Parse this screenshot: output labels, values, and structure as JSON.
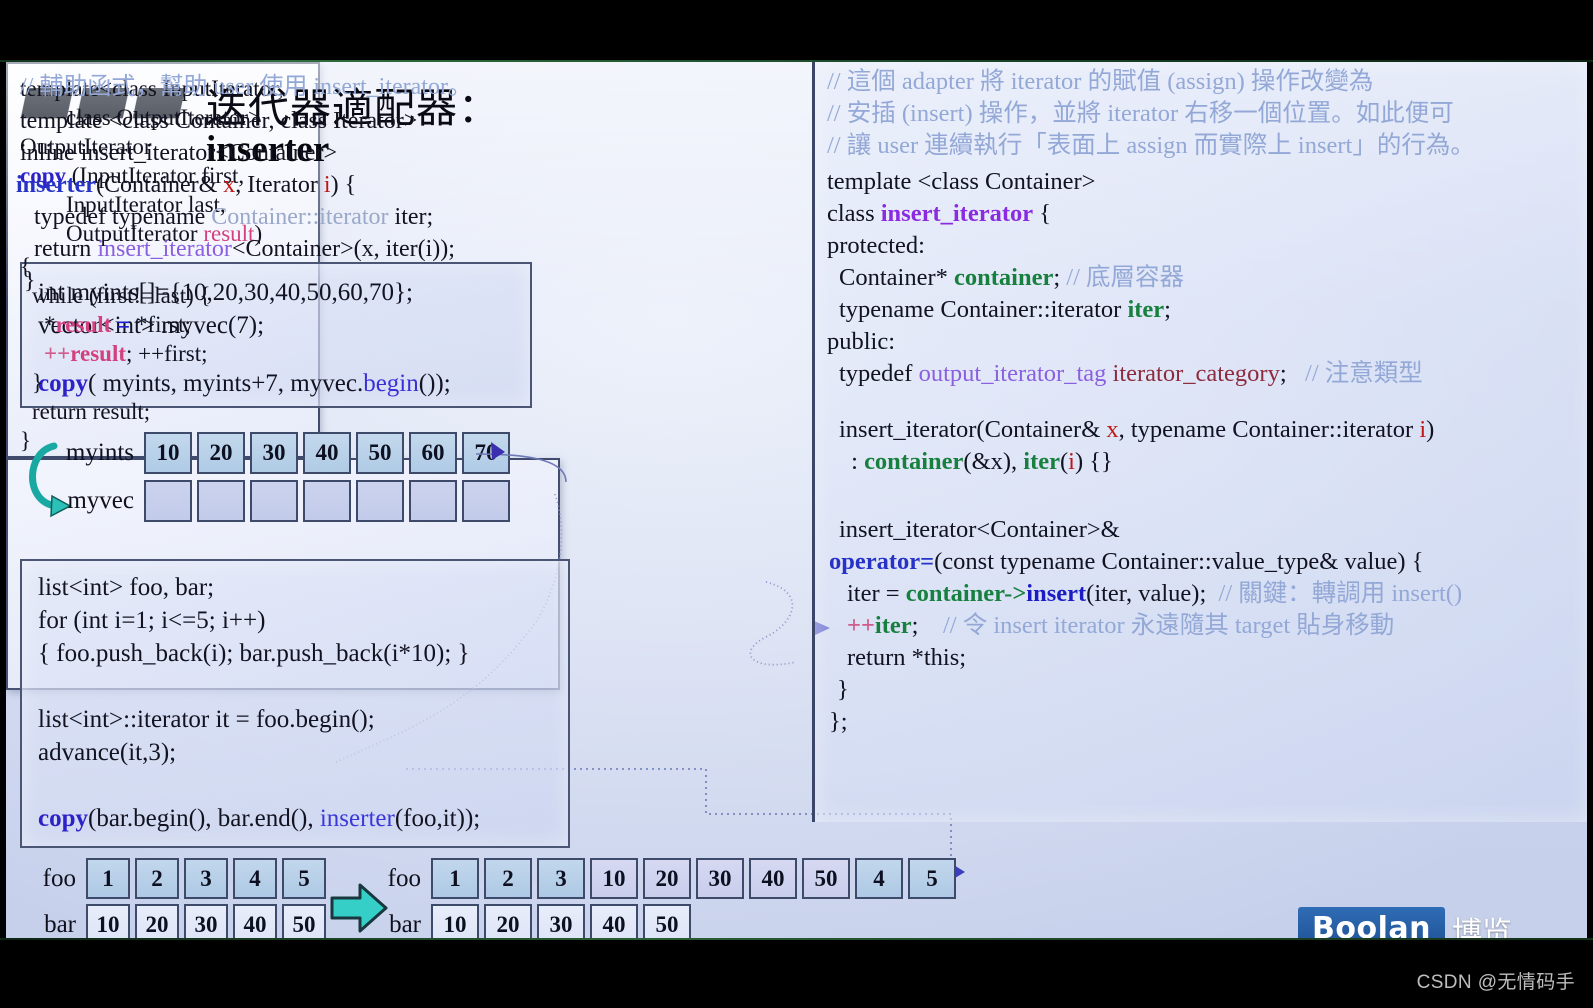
{
  "slide": {
    "title_zh": "迭代器適配器：",
    "title_en": "inserter",
    "tiles_count": 3
  },
  "code_vector_example": {
    "line1": "int myints[]={10,20,30,40,50,60,70};",
    "line2": "vector<int> myvec(7);",
    "line3_copy": "copy",
    "line3_mid": "( myints, myints+7, myvec.",
    "line3_begin": "begin",
    "line3_end": "());"
  },
  "vector_diagram": {
    "label_top": "myints",
    "label_bottom": "myvec",
    "values_top": [
      "10",
      "20",
      "30",
      "40",
      "50",
      "60",
      "70"
    ],
    "values_bottom": [
      "",
      "",
      "",
      "",
      "",
      "",
      ""
    ]
  },
  "code_list_example": {
    "line1": "list<int> foo, bar;",
    "line2": "for (int i=1; i<=5; i++)",
    "line3": "{ foo.push_back(i); bar.push_back(i*10); }",
    "line4": "list<int>::iterator it = foo.begin();",
    "line5": "advance(it,3);",
    "line6_copy": "copy",
    "line6_mid": "(bar.begin(), bar.end(), ",
    "line6_inserter": "inserter",
    "line6_end": "(foo,it));"
  },
  "copy_box": {
    "l1": "template<class InputIterator,",
    "l2": "class OutputIterator>",
    "l3": "OutputIterator",
    "l4_copy": "copy",
    "l4_rest": " (InputIterator first,",
    "l5": "InputIterator last,",
    "l6_pre": "OutputIterator ",
    "l6_result": "result",
    "l6_post": ")",
    "l7": "{",
    "l8": "while (first!=last) {",
    "l9_pre": "*",
    "l9_result": "result",
    "l9_eq": " = ",
    "l9_post": "*first;",
    "l10_pre": "++",
    "l10_result": "result",
    "l10_post": "; ++first;",
    "l11": "}",
    "l12": "return result;",
    "l13": "}"
  },
  "right_panel": {
    "comment1": "// 這個 adapter 將 iterator 的賦值 (assign) 操作改變為",
    "comment2": "// 安插 (insert) 操作，並將 iterator 右移一個位置。如此便可",
    "comment3": "// 讓 user 連續執行「表面上 assign 而實際上 insert」的行為。",
    "l4": "template <class Container>",
    "l5_pre": "class ",
    "l5_cls": "insert_iterator",
    "l5_post": " {",
    "l6": "protected:",
    "l7_pre": "Container* ",
    "l7_id": "container",
    "l7_mid": "; ",
    "l7_cmt": "// 底層容器",
    "l8_pre": "typename Container::iterator ",
    "l8_id": "iter",
    "l8_post": ";",
    "l9": "public:",
    "l10_pre": "typedef ",
    "l10_tag": "output_iterator_tag",
    "l10_mid": " ",
    "l10_cat": "iterator_category",
    "l10_post": ";   ",
    "l10_cmt": "// 注意類型",
    "l11_pre": "insert_iterator(Container& ",
    "l11_x": "x",
    "l11_mid": ", typename Container::iterator ",
    "l11_i": "i",
    "l11_post": ")",
    "l12_pre": " : ",
    "l12_container": "container",
    "l12_mid1": "(&x), ",
    "l12_iter": "iter",
    "l12_mid2": "(",
    "l12_i": "i",
    "l12_post": ") {}",
    "l13": "insert_iterator<Container>&",
    "l14_op": "operator=",
    "l14_rest": "(const typename Container::value_type& value) {",
    "l15_pre": "iter = ",
    "l15_container": "container",
    "l15_arrow": "->",
    "l15_insert": "insert",
    "l15_args": "(iter, value);  ",
    "l15_cmt": "// 關鍵：轉調用 insert()",
    "l16_pp": "++",
    "l16_iter": "iter",
    "l16_semi": ";    ",
    "l16_cmt": "// 令 insert iterator 永遠隨其 target 貼身移動",
    "l17": "return *this;",
    "l18": "}",
    "l19": "};"
  },
  "helper_box": {
    "comment": "// 輔助函式，幫助 user 使用 insert_iterator。",
    "l2": "template <class Container, class Iterator>",
    "l3": "inline insert_iterator<Container>",
    "l4_fn": "inserter",
    "l4_pre": "(Container& ",
    "l4_x": "x",
    "l4_mid": ", Iterator ",
    "l4_i": "i",
    "l4_post": ") {",
    "l5_pre": "typedef typename ",
    "l5_type": "Container::iterator",
    "l5_post": " iter;",
    "l6_pre": "return ",
    "l6_type": "insert_iterator",
    "l6_post": "<Container>(x, iter(i));",
    "l7": "}"
  },
  "before_diagram": {
    "label_top": "foo",
    "label_bottom": "bar",
    "foo": [
      "1",
      "2",
      "3",
      "4",
      "5"
    ],
    "bar": [
      "10",
      "20",
      "30",
      "40",
      "50"
    ]
  },
  "after_diagram": {
    "label_top": "foo",
    "label_bottom": "bar",
    "foo": [
      "1",
      "2",
      "3",
      "10",
      "20",
      "30",
      "40",
      "50",
      "4",
      "5"
    ],
    "foo_inserted_index": [
      3,
      4,
      5,
      6,
      7
    ],
    "bar": [
      "10",
      "20",
      "30",
      "40",
      "50"
    ]
  },
  "branding": {
    "logo_text": "Boolan",
    "logo_cn": "博览",
    "watermark": "CSDN @无情码手"
  },
  "colors": {
    "accent_teal": "#2bb6b0",
    "keyword_blue": "#2d21c8",
    "class_purple": "#8a2be2",
    "member_green": "#17803e",
    "comment_blue": "#93a8d6",
    "result_pink": "#d2407e",
    "logo_blue": "#2f6db5"
  }
}
